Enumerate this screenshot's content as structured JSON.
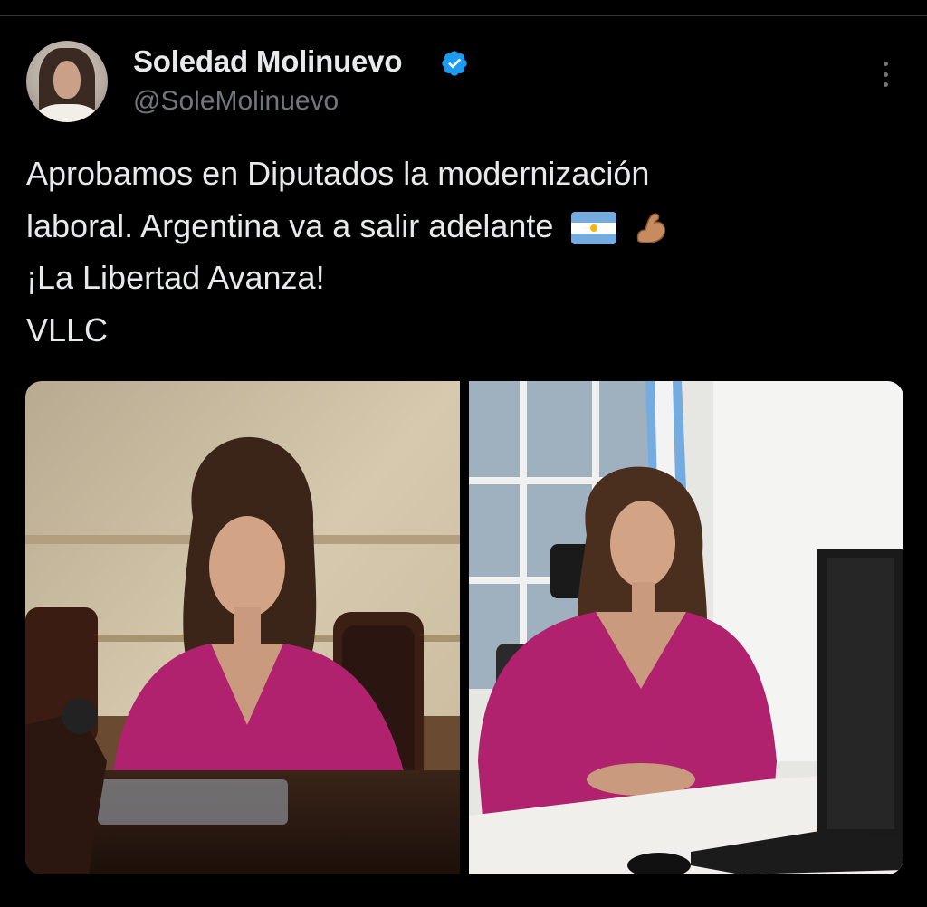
{
  "author": {
    "name": "Soledad Molinuevo",
    "handle": "@SoleMolinuevo",
    "verified": true
  },
  "tweet": {
    "lines": [
      "Aprobamos en Diputados la modernización",
      "laboral. Argentina va a salir adelante",
      "¡La Libertad Avanza!",
      "VLLC"
    ],
    "emojis": [
      "flag-argentina-icon",
      "flexed-biceps-icon"
    ]
  },
  "media": {
    "count": 2,
    "images": [
      "photo-congress-desk",
      "photo-office-desk"
    ]
  },
  "colors": {
    "background": "#000000",
    "text": "#e7e9ea",
    "secondary": "#71767b",
    "verified": "#1d9bf0",
    "blouse": "#b0216e"
  },
  "icons": [
    "verified-badge-icon",
    "more-options-icon"
  ]
}
